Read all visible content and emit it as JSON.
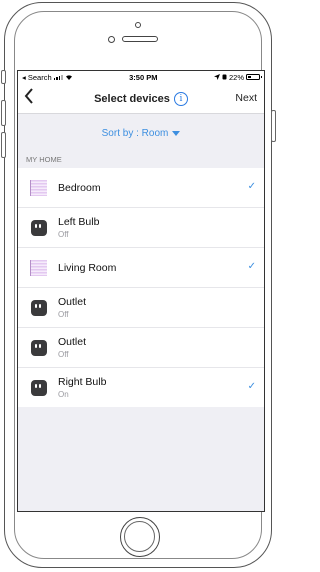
{
  "status": {
    "back_app": "◂ Search",
    "time": "3:50 PM",
    "battery": "22%"
  },
  "nav": {
    "title": "Select devices",
    "next": "Next"
  },
  "sort": {
    "label": "Sort by : Room"
  },
  "section": {
    "label": "MY HOME"
  },
  "devices": [
    {
      "name": "Bedroom",
      "sub": "",
      "type": "room",
      "checked": true
    },
    {
      "name": "Left Bulb",
      "sub": "Off",
      "type": "bulb",
      "checked": false
    },
    {
      "name": "Living Room",
      "sub": "",
      "type": "room",
      "checked": true
    },
    {
      "name": "Outlet",
      "sub": "Off",
      "type": "bulb",
      "checked": false
    },
    {
      "name": "Outlet",
      "sub": "Off",
      "type": "bulb",
      "checked": false
    },
    {
      "name": "Right Bulb",
      "sub": "On",
      "type": "bulb",
      "checked": true
    }
  ],
  "icons": {
    "check": "✓",
    "back": "chevron-left-icon",
    "info": "info-icon"
  },
  "colors": {
    "accent": "#3d8fe0",
    "background": "#efeff4"
  }
}
